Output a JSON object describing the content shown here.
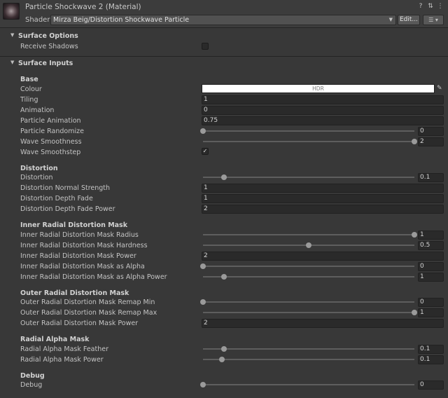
{
  "header": {
    "title": "Particle Shockwave 2 (Material)",
    "shader_label": "Shader",
    "shader_value": "Mirza Beig/Distortion Shockwave Particle",
    "edit_label": "Edit...",
    "help_icon": "help-icon",
    "settings_icon": "sliders-icon",
    "menu_icon": "kebab-menu-icon",
    "list_icon": "list-icon"
  },
  "sections": {
    "surface_options": {
      "title": "Surface Options",
      "receive_shadows_label": "Receive Shadows",
      "receive_shadows_checked": false
    },
    "surface_inputs": {
      "title": "Surface Inputs"
    }
  },
  "base": {
    "title": "Base",
    "colour_label": "Colour",
    "colour_hdr": "HDR",
    "colour_value": "#ffffff",
    "tiling_label": "Tiling",
    "tiling_value": "1",
    "animation_label": "Animation",
    "animation_value": "0",
    "particle_animation_label": "Particle Animation",
    "particle_animation_value": "0.75",
    "particle_randomize_label": "Particle Randomize",
    "particle_randomize_value": "0",
    "wave_smoothness_label": "Wave Smoothness",
    "wave_smoothness_value": "2",
    "wave_smoothstep_label": "Wave Smoothstep",
    "wave_smoothstep_checked": true
  },
  "distortion": {
    "title": "Distortion",
    "distortion_label": "Distortion",
    "distortion_value": "0.1",
    "normal_strength_label": "Distortion Normal Strength",
    "normal_strength_value": "1",
    "depth_fade_label": "Distortion Depth Fade",
    "depth_fade_value": "1",
    "depth_fade_power_label": "Distortion Depth Fade Power",
    "depth_fade_power_value": "2"
  },
  "inner_mask": {
    "title": "Inner Radial Distortion Mask",
    "radius_label": "Inner Radial Distortion Mask Radius",
    "radius_value": "1",
    "hardness_label": "Inner Radial Distortion Mask Hardness",
    "hardness_value": "0.5",
    "power_label": "Inner Radial Distortion Mask Power",
    "power_value": "2",
    "as_alpha_label": "Inner Radial Distortion Mask as Alpha",
    "as_alpha_value": "0",
    "as_alpha_power_label": "Inner Radial Distortion Mask as Alpha Power",
    "as_alpha_power_value": "1"
  },
  "outer_mask": {
    "title": "Outer Radial Distortion Mask",
    "remap_min_label": "Outer Radial Distortion Mask Remap Min",
    "remap_min_value": "0",
    "remap_max_label": "Outer Radial Distortion Mask Remap Max",
    "remap_max_value": "1",
    "power_label": "Outer Radial Distortion Mask Power",
    "power_value": "2"
  },
  "radial_alpha": {
    "title": "Radial Alpha Mask",
    "feather_label": "Radial Alpha Mask Feather",
    "feather_value": "0.1",
    "power_label": "Radial Alpha Mask Power",
    "power_value": "0.1"
  },
  "debug": {
    "title": "Debug",
    "debug_label": "Debug",
    "debug_value": "0"
  },
  "sliders": {
    "particle_randomize": 0.0,
    "wave_smoothness": 1.0,
    "distortion": 0.1,
    "inner_radius": 1.0,
    "inner_hardness": 0.5,
    "inner_as_alpha": 0.0,
    "inner_as_alpha_power": 0.1,
    "outer_remap_min": 0.0,
    "outer_remap_max": 1.0,
    "radial_feather": 0.1,
    "radial_power": 0.09,
    "debug": 0.0
  }
}
